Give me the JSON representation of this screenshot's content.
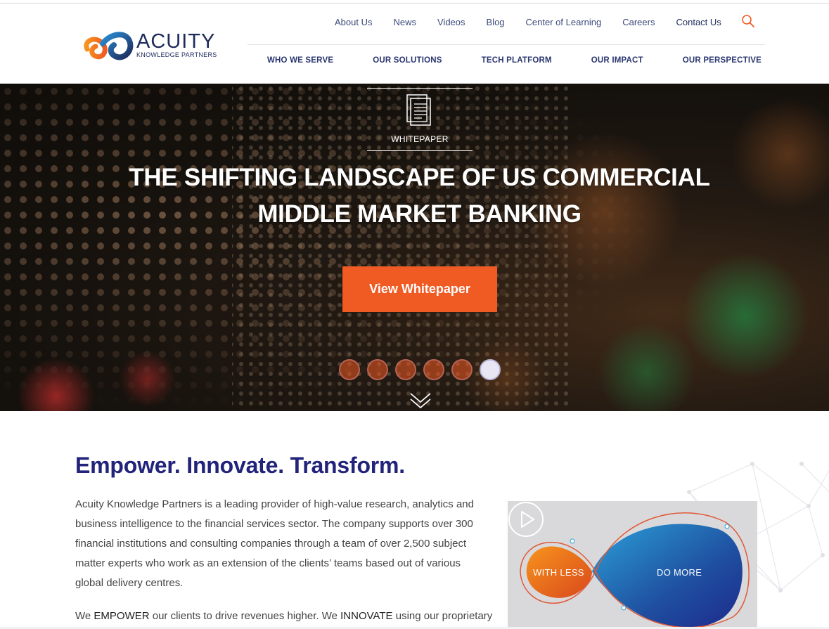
{
  "brand": {
    "name": "ACUITY",
    "tagline": "KNOWLEDGE PARTNERS",
    "colors": {
      "navy": "#1d2a5c",
      "orange": "#f05a23",
      "blue": "#1f6fb5"
    }
  },
  "utility_nav": {
    "items": [
      "About Us",
      "News",
      "Videos",
      "Blog",
      "Center of Learning",
      "Careers",
      "Contact Us"
    ],
    "search_icon": "search-icon"
  },
  "main_nav": {
    "items": [
      "WHO WE SERVE",
      "OUR SOLUTIONS",
      "TECH PLATFORM",
      "OUR IMPACT",
      "OUR PERSPECTIVE"
    ]
  },
  "hero": {
    "tag_icon": "document-icon",
    "tag_label": "WHITEPAPER",
    "title_line1": "THE SHIFTING LANDSCAPE OF US COMMERCIAL",
    "title_line2": "MIDDLE MARKET BANKING",
    "cta_label": "View Whitepaper",
    "slides_total": 6,
    "active_slide": 6,
    "scroll_icon": "double-chevron-down-icon"
  },
  "intro": {
    "heading": "Empower. Innovate. Transform.",
    "paragraph_lines": [
      "Acuity Knowledge Partners is a leading provider of high-value research, analytics and",
      "business intelligence to the financial services sector. The company supports over 300",
      "financial institutions and consulting companies through a team of over 2,500 subject",
      "matter experts who work as an extension of the clients’ teams based out of various",
      "global delivery centres."
    ],
    "p2_a": "We ",
    "p2_b": "EMPOWER",
    "p2_c": " our clients to drive revenues higher. We ",
    "p2_d": "INNOVATE",
    "p2_e": " using our proprietary"
  },
  "video": {
    "left_label": "WITH LESS",
    "right_label": "DO MORE",
    "play_icon": "play-icon"
  }
}
